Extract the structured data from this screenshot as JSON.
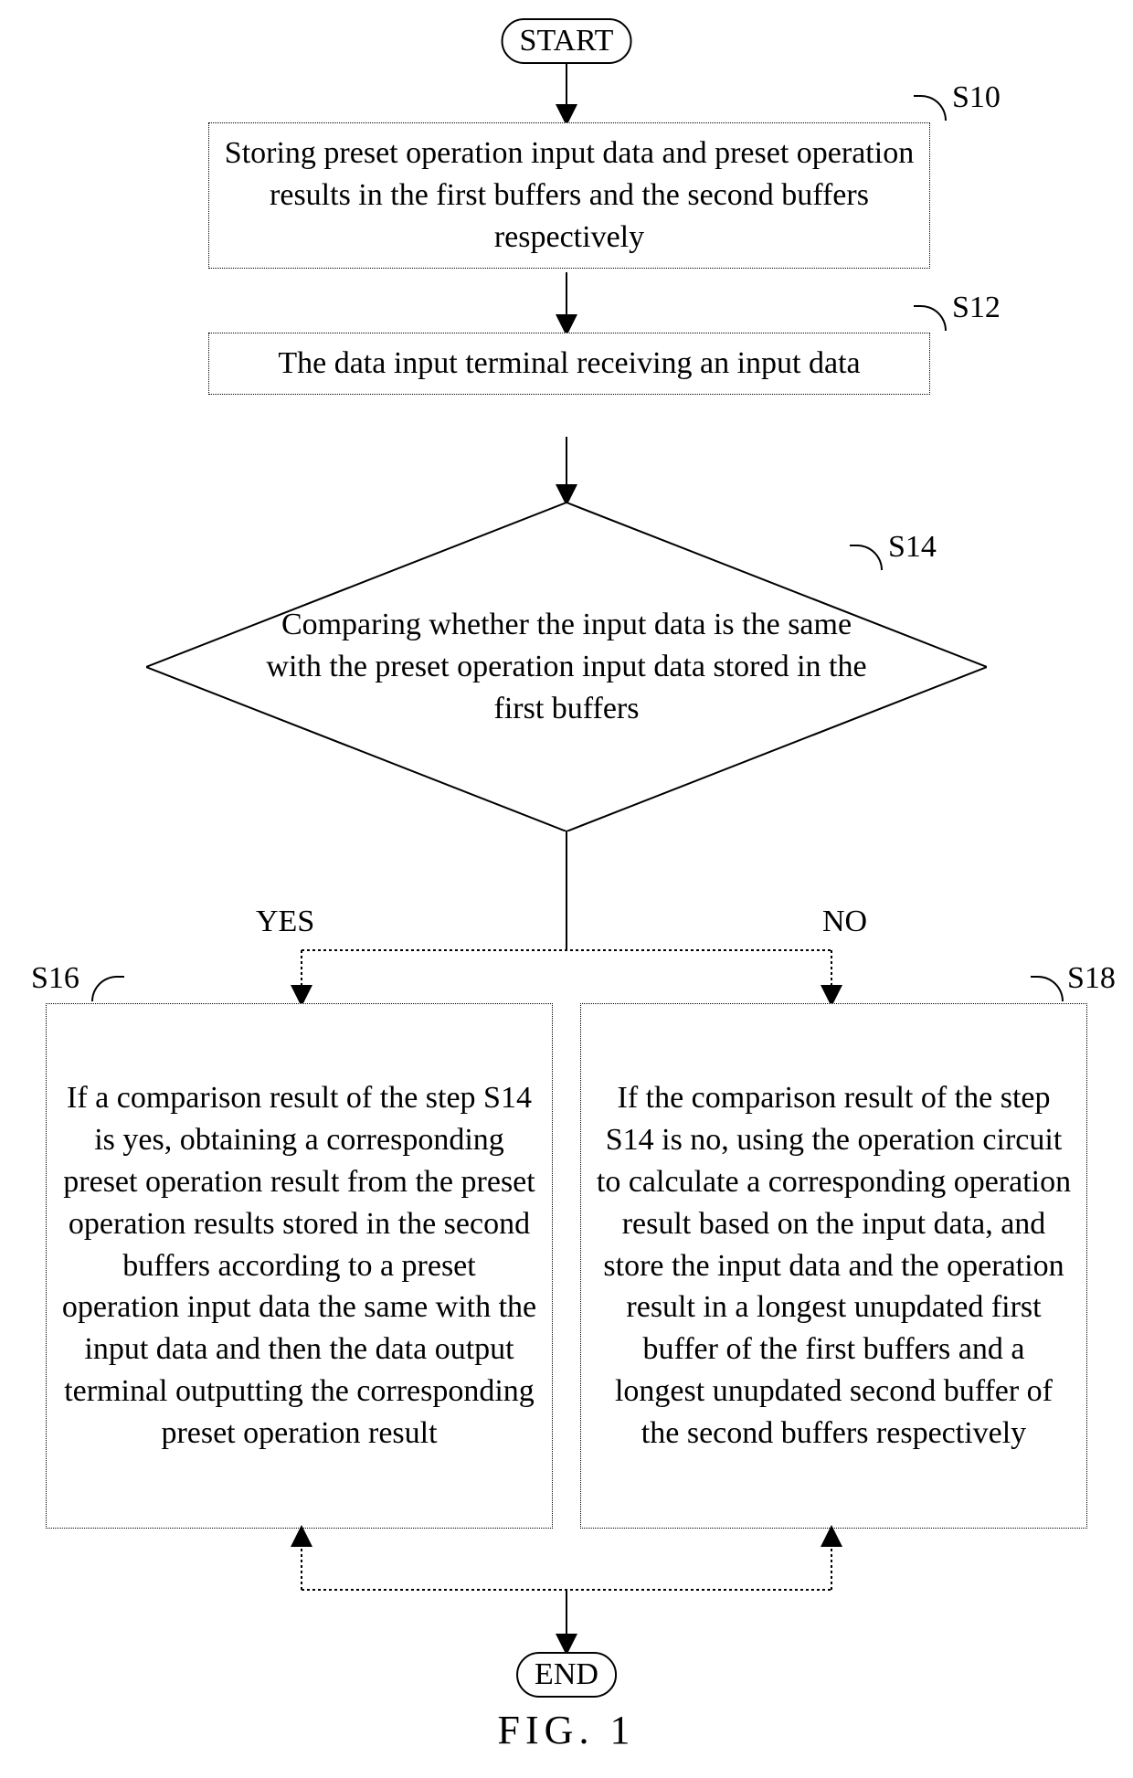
{
  "flow": {
    "start": "START",
    "end": "END",
    "s10": {
      "id": "S10",
      "text": "Storing preset operation input data and preset operation results in the first buffers and the second buffers respectively"
    },
    "s12": {
      "id": "S12",
      "text": "The data input terminal receiving an input data"
    },
    "s14": {
      "id": "S14",
      "text": "Comparing whether the input data is the same with the preset operation input data stored in the first buffers"
    },
    "s16": {
      "id": "S16",
      "text": "If a comparison result of the step S14 is yes, obtaining a corresponding preset operation result from the preset operation results stored in the second buffers according to a preset operation input data the same with the input data and then the data output terminal outputting the corresponding preset operation result"
    },
    "s18": {
      "id": "S18",
      "text": "If the comparison result of the step S14 is no, using the operation circuit to calculate a corresponding operation result based on the input data, and store the input data and the operation result in a longest unupdated first buffer of the first buffers and a longest unupdated second buffer of the second buffers respectively"
    },
    "yes": "YES",
    "no": "NO",
    "figure": "FIG. 1"
  }
}
